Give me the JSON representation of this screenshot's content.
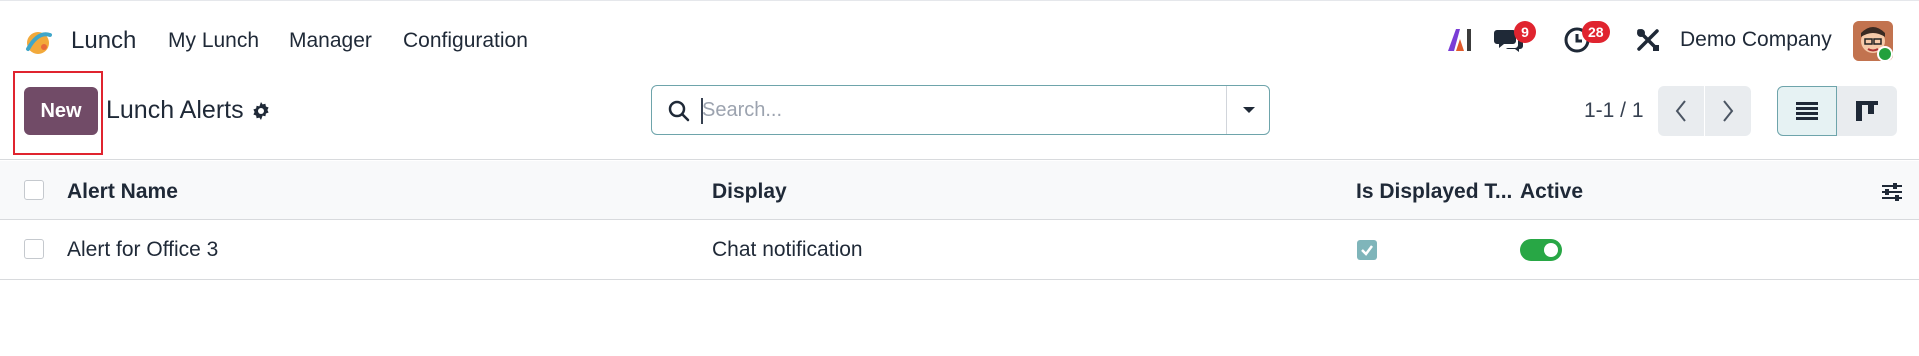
{
  "app": {
    "name": "Lunch"
  },
  "menu": {
    "items": [
      "My Lunch",
      "Manager",
      "Configuration"
    ]
  },
  "systray": {
    "messages_count": "9",
    "activities_count": "28",
    "company": "Demo Company"
  },
  "control": {
    "new_label": "New",
    "breadcrumb": "Lunch Alerts",
    "search_placeholder": "Search...",
    "pager": "1-1 / 1"
  },
  "table": {
    "columns": [
      "Alert Name",
      "Display",
      "Is Displayed T...",
      "Active"
    ],
    "rows": [
      {
        "name": "Alert for Office 3",
        "display": "Chat notification",
        "is_displayed": true,
        "active": true
      }
    ]
  },
  "colors": {
    "brand": "#714b67",
    "highlight": "#e0242f",
    "toggle_on": "#28a745",
    "check": "#7fb5ba"
  }
}
